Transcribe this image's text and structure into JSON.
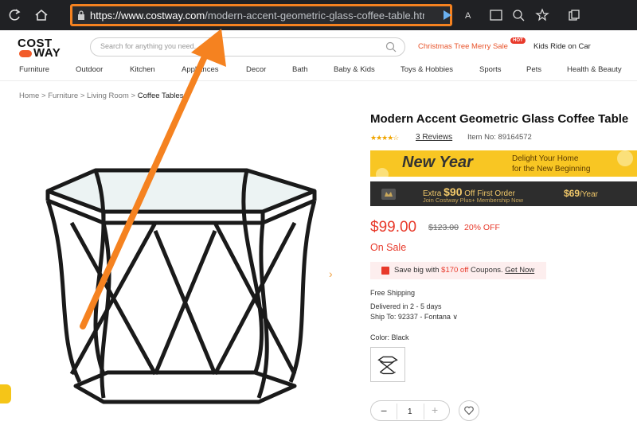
{
  "browser": {
    "url_host": "https://www.costway.com",
    "url_path": "/modern-accent-geometric-glass-coffee-table.html?ran..."
  },
  "site": {
    "logo_line1": "COST",
    "logo_line2": "WAY",
    "search_placeholder": "Search for anything you need...",
    "promo_christmas": "Christmas Tree Merry Sale",
    "hot_badge": "HOT",
    "promo_kids": "Kids Ride on Car",
    "categories": [
      "Furniture",
      "Outdoor",
      "Kitchen",
      "Appliances",
      "Decor",
      "Bath",
      "Baby & Kids",
      "Toys & Hobbies",
      "Sports",
      "Pets",
      "Health & Beauty"
    ]
  },
  "breadcrumb": {
    "home": "Home",
    "sep": ">",
    "furniture": "Furniture",
    "living_room": "Living Room",
    "current": "Coffee Tables"
  },
  "product": {
    "title": "Modern Accent Geometric Glass Coffee Table",
    "stars": "★★★★☆",
    "reviews": "3 Reviews",
    "item_no": "Item No: 89164572",
    "banner_new_year": "New Year",
    "banner_new_year_sub1": "Delight Your Home",
    "banner_new_year_sub2": "for the New Beginning",
    "plus_extra_pre": "Extra ",
    "plus_extra_amount": "$90",
    "plus_extra_post": " Off First Order",
    "plus_join": "Join Costway Plus+ Membership Now",
    "plus_price": "$69",
    "plus_price_unit": "/Year",
    "price": "$99.00",
    "old_price": "$123.00",
    "discount": "20% OFF",
    "on_sale": "On Sale",
    "coupon_pre": "Save big with ",
    "coupon_amount": "$170 off",
    "coupon_mid": " Coupons. ",
    "coupon_link": "Get Now",
    "shipping": "Free Shipping",
    "delivery": "Delivered in 2 - 5 days",
    "ship_to": "Ship To: 92337 - Fontana ∨",
    "color_label": "Color: Black",
    "qty_minus": "−",
    "qty_value": "1",
    "qty_plus": "+",
    "next_arrow": "›"
  },
  "colors": {
    "accent_orange": "#f58220",
    "sale_red": "#e8392a",
    "banner_yellow": "#f8c623"
  }
}
